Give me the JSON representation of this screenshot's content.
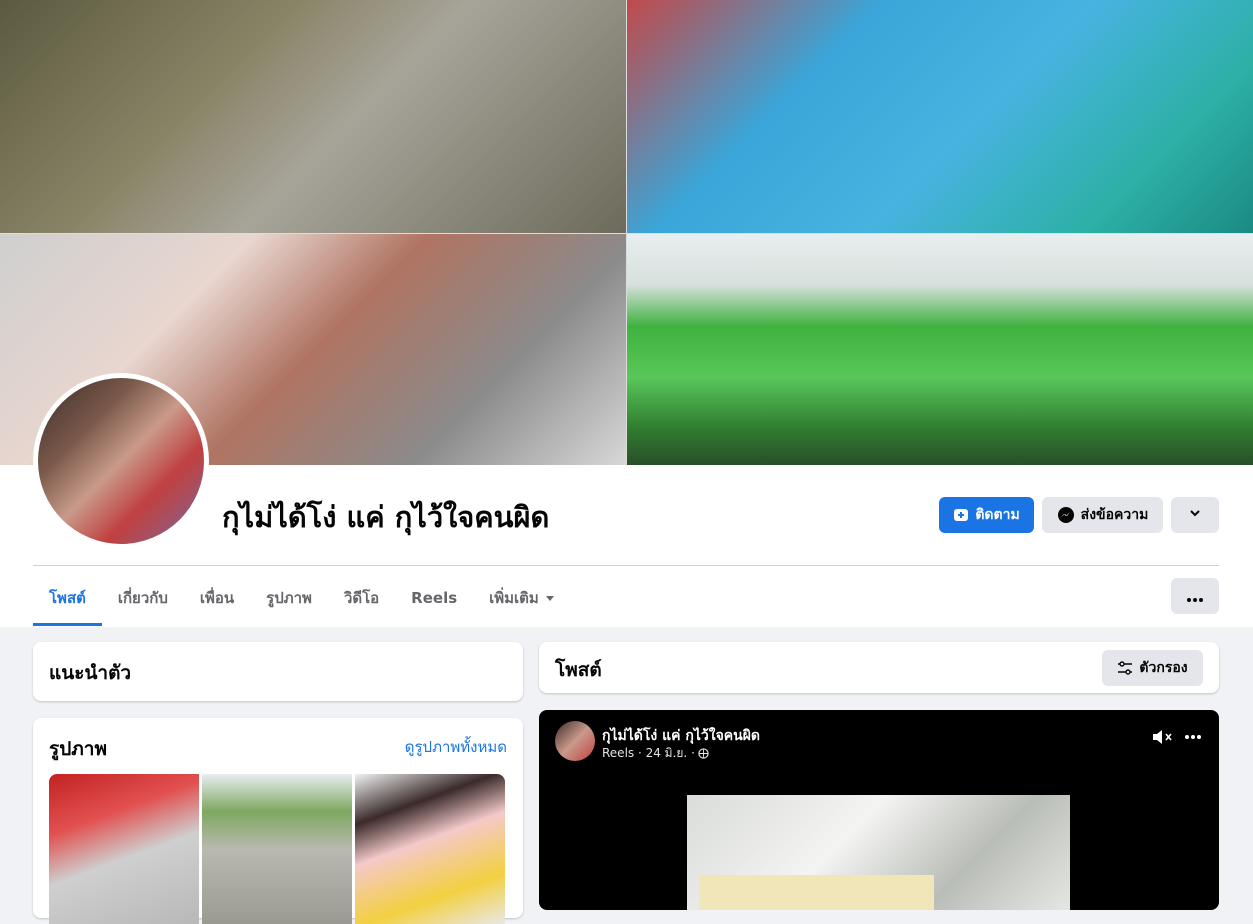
{
  "profile": {
    "name": "กุไม่ได้โง่ แค่ กุไว้ใจคนผิด"
  },
  "actions": {
    "follow_label": "ติดตาม",
    "message_label": "ส่งข้อความ"
  },
  "tabs": [
    {
      "label": "โพสต์",
      "active": true
    },
    {
      "label": "เกี่ยวกับ",
      "active": false
    },
    {
      "label": "เพื่อน",
      "active": false
    },
    {
      "label": "รูปภาพ",
      "active": false
    },
    {
      "label": "วิดีโอ",
      "active": false
    },
    {
      "label": "Reels",
      "active": false
    },
    {
      "label": "เพิ่มเติม",
      "active": false
    }
  ],
  "intro": {
    "title": "แนะนำตัว"
  },
  "photos": {
    "title": "รูปภาพ",
    "see_all": "ดูรูปภาพทั้งหมด"
  },
  "posts": {
    "title": "โพสต์",
    "filter_label": "ตัวกรอง"
  },
  "reel_post": {
    "author": "กุไม่ได้โง่ แค่ กุไว้ใจคนผิด",
    "meta": "Reels · 24 มิ.ย. ·"
  },
  "colors": {
    "accent": "#1b74e4",
    "background": "#f0f2f5",
    "button_gray": "#e4e6eb"
  }
}
